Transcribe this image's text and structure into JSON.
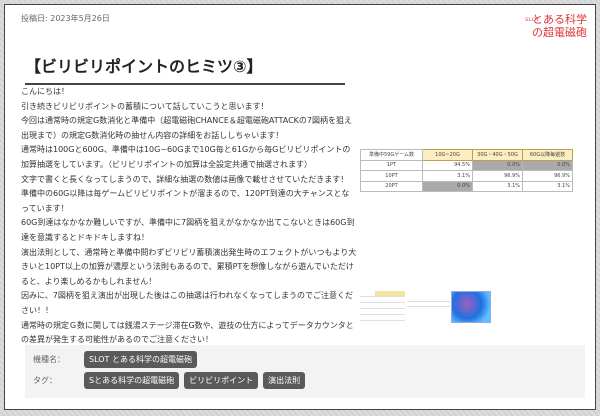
{
  "post_date": "投稿日: 2023年5月26日",
  "logo_text": "とある科学の超電磁砲",
  "logo_small": "SLOT",
  "title": "【ビリビリポイントのヒミツ③】",
  "paragraphs": [
    "こんにちは！",
    "引き続きビリビリポイントの蓄積について話していこうと思います！",
    "今回は通常時の規定G数消化と準備中（超電磁砲CHANCE＆超電磁砲ATTACKの7図柄を狙え出現まで）の規定G数消化時の抽せん内容の詳細をお話ししちゃいます！",
    "通常時は100Gと600G、準備中は10G~60Gまで10G毎と61Gから毎Gビリビリポイントの加算抽選をしています。（ビリビリポイントの加算は全設定共通で抽選されます）",
    "文字で書くと長くなってしまうので、詳細な抽選の数値は画像で載せさせていただきます！",
    "準備中の60G以降は毎ゲームビリビリポイントが溜まるので、120PT到達の大チャンスとなっています！",
    "60G到達はなかなか難しいですが、準備中に7図柄を狙えがなかなか出てこないときは60G到達を意識するとドキドキしますね！",
    "演出法則として、通常時と準備中問わずビリビリ蓄積演出発生時のエフェクトがいつもより大きいと10PT以上の加算が濃厚という法則もあるので、累積PTを想像しながら遊んでいただけると、より楽しめるかもしれません！",
    "因みに、7図柄を狙え演出が出現した後はこの抽選は行われなくなってしまうのでご注意ください！！",
    "通常時の規定Ｇ数に関しては銭湯ステージ滞在G数や、遊技の仕方によってデータカウンタとの差異が発生する可能性があるのでご注意ください！"
  ],
  "table": {
    "headers": [
      "準備中59Gゲーム数",
      "10G~20G",
      "30G・40G・50G",
      "60G以降毎遊技"
    ],
    "rows": [
      [
        "1PT",
        "94.5%",
        "0.0%",
        "0.0%"
      ],
      [
        "10PT",
        "3.1%",
        "96.9%",
        "96.9%"
      ],
      [
        "20PT",
        "0.0%",
        "3.1%",
        "3.1%"
      ]
    ]
  },
  "meta": {
    "model_label": "機種名：",
    "model_tags": [
      "SLOT とある科学の超電磁砲"
    ],
    "tag_label": "タグ：",
    "tags": [
      "Sとある科学の超電磁砲",
      "ビリビリポイント",
      "演出法則"
    ]
  }
}
